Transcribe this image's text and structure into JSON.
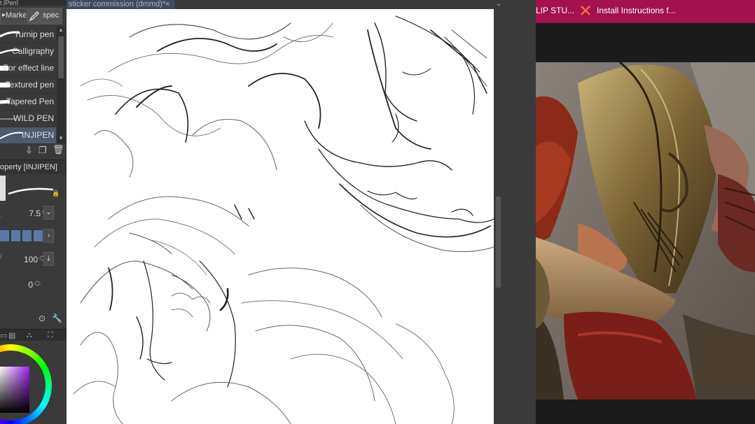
{
  "left_panel": {
    "sub_tool_header": "t [Pen]",
    "group_tabs": [
      {
        "label": "Marke",
        "icon": "marker-icon"
      },
      {
        "label": "spec",
        "icon": "pen-icon"
      }
    ],
    "brushes": [
      {
        "label": "Turnip pen"
      },
      {
        "label": "Calligraphy"
      },
      {
        "label": "For effect line"
      },
      {
        "label": "Textured pen"
      },
      {
        "label": "Tapered Pen"
      },
      {
        "label": "WILD PEN"
      },
      {
        "label": "INJIPEN",
        "selected": true
      }
    ],
    "property_title": "operty [INJIPEN]",
    "brush_size": "7.5",
    "opacity": "100",
    "extra_value": "0"
  },
  "canvas": {
    "document_tab": "sticker commission (dmmd)*",
    "close_symbol": "×"
  },
  "browser": {
    "tabs": [
      {
        "label": "LIP STU..."
      },
      {
        "label": "Install Instructions f..."
      }
    ]
  },
  "colors": {
    "panel_bg": "#3a3a3a",
    "selection": "#4d5a70",
    "browser_tab_bar": "#a3114f"
  }
}
